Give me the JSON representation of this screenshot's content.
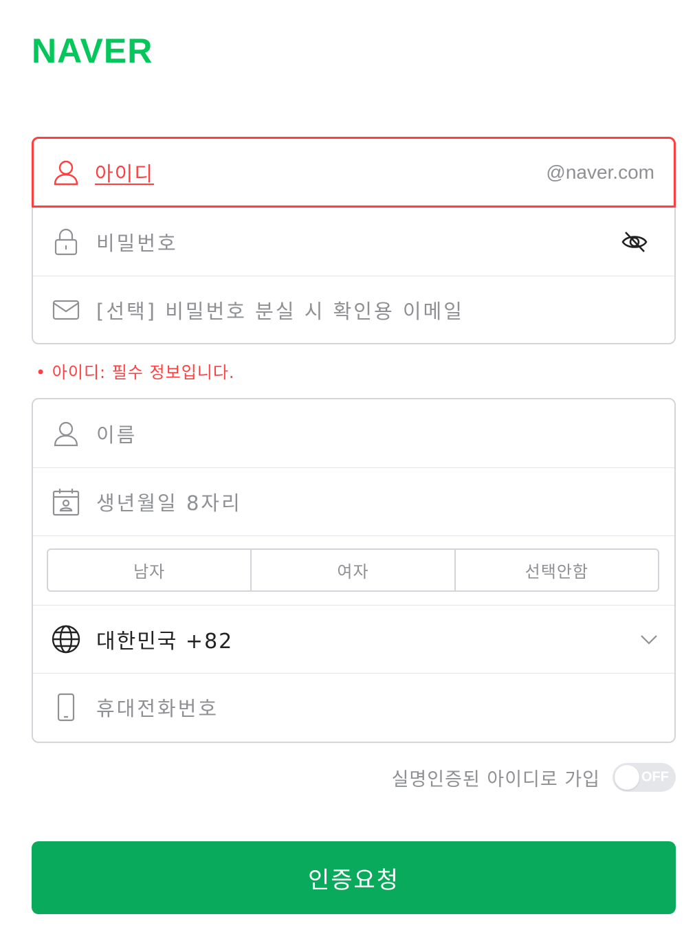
{
  "brand": {
    "logo": "NAVER",
    "color": "#03c75a"
  },
  "account": {
    "id_placeholder": "아이디",
    "id_suffix": "@naver.com",
    "password_placeholder": "비밀번호",
    "email_placeholder": "[선택] 비밀번호 분실 시 확인용 이메일"
  },
  "error": {
    "message": "• 아이디: 필수 정보입니다."
  },
  "profile": {
    "name_placeholder": "이름",
    "birth_placeholder": "생년월일 8자리",
    "gender_options": [
      "남자",
      "여자",
      "선택안함"
    ],
    "country": "대한민국 +82",
    "phone_placeholder": "휴대전화번호"
  },
  "realname": {
    "label": "실명인증된 아이디로 가입",
    "toggle_text": "OFF"
  },
  "submit": {
    "label": "인증요청"
  },
  "colors": {
    "error": "#ff3f3f",
    "primary": "#09aa5c",
    "border": "#d3d5da"
  }
}
